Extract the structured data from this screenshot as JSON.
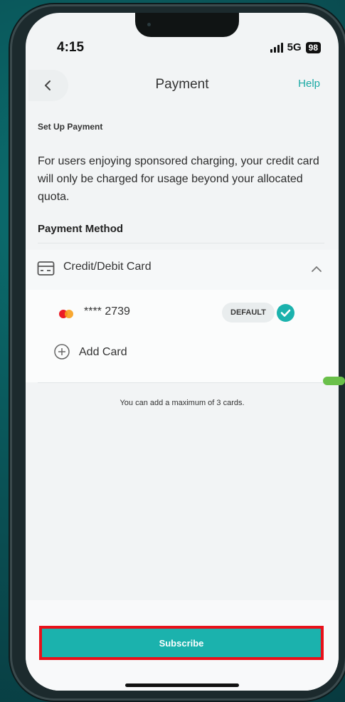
{
  "status_bar": {
    "time": "4:15",
    "network": "5G",
    "battery": "98"
  },
  "header": {
    "title": "Payment",
    "help_label": "Help"
  },
  "setup": {
    "heading": "Set Up Payment",
    "description": "For users enjoying sponsored charging, your credit card will only be charged for usage beyond your allocated quota."
  },
  "payment_method": {
    "heading": "Payment Method",
    "type_label": "Credit/Debit Card",
    "cards": [
      {
        "number": "**** 2739",
        "badge": "DEFAULT",
        "brand_icon": "mastercard-icon",
        "selected": true
      }
    ],
    "add_card_label": "Add Card",
    "note": "You can add a maximum of 3 cards."
  },
  "footer": {
    "subscribe_label": "Subscribe"
  },
  "colors": {
    "accent": "#1bb2ad",
    "highlight_border": "#e8111a"
  },
  "icons": [
    "back-chevron-icon",
    "card-icon",
    "chevron-up-icon",
    "mastercard-icon",
    "check-icon",
    "plus-circle-icon"
  ]
}
